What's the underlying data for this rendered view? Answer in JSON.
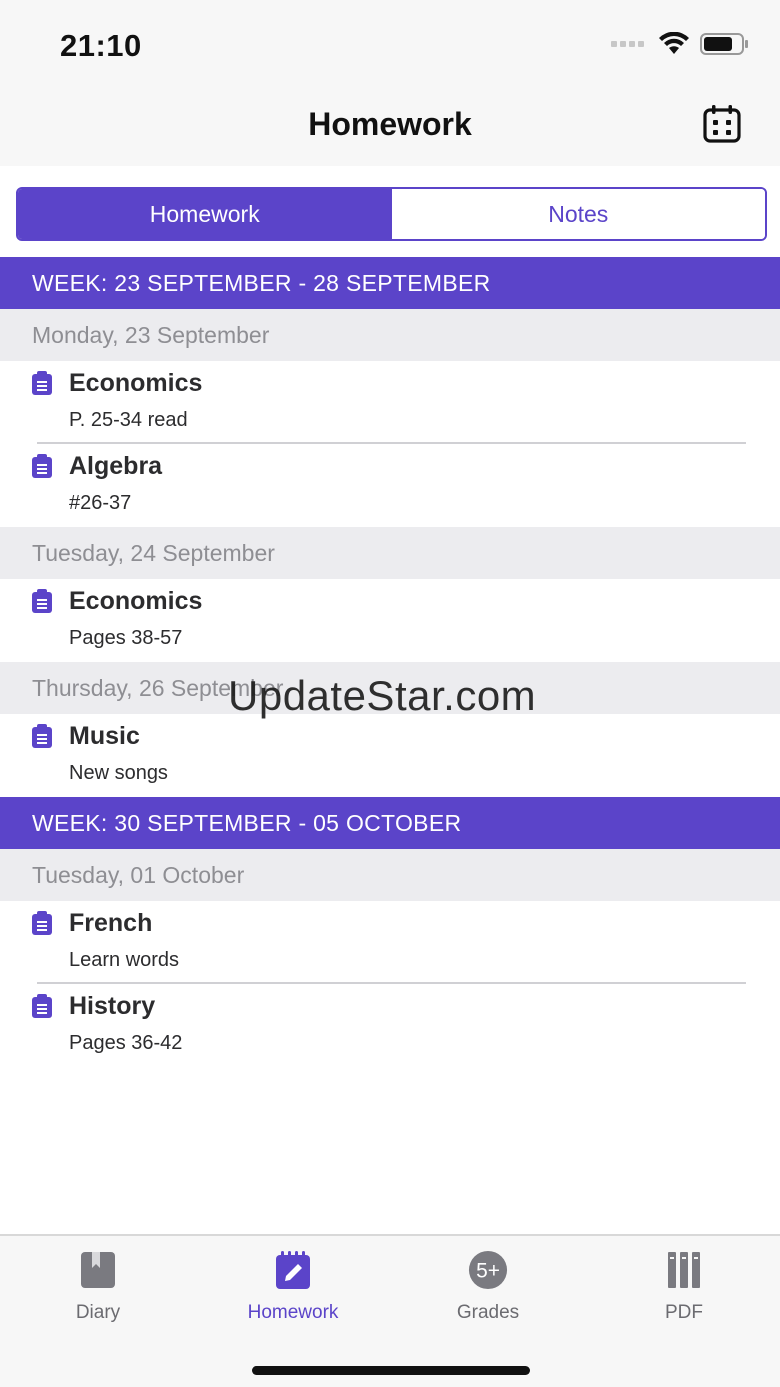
{
  "status": {
    "time": "21:10"
  },
  "nav": {
    "title": "Homework"
  },
  "segments": {
    "homework": "Homework",
    "notes": "Notes"
  },
  "weeks": [
    {
      "label": "WEEK: 23 SEPTEMBER - 28 SEPTEMBER",
      "days": [
        {
          "label": "Monday, 23 September",
          "items": [
            {
              "subject": "Economics",
              "task": "P. 25-34 read"
            },
            {
              "subject": "Algebra",
              "task": "#26-37"
            }
          ]
        },
        {
          "label": "Tuesday, 24 September",
          "items": [
            {
              "subject": "Economics",
              "task": "Pages 38-57"
            }
          ]
        },
        {
          "label": "Thursday, 26 September",
          "items": [
            {
              "subject": "Music",
              "task": "New songs"
            }
          ]
        }
      ]
    },
    {
      "label": "WEEK: 30 SEPTEMBER - 05 OCTOBER",
      "days": [
        {
          "label": "Tuesday, 01 October",
          "items": [
            {
              "subject": "French",
              "task": "Learn words"
            },
            {
              "subject": "History",
              "task": "Pages 36-42"
            }
          ]
        }
      ]
    }
  ],
  "watermark": "UpdateStar.com",
  "tabs": {
    "diary": "Diary",
    "homework": "Homework",
    "grades": "Grades",
    "grades_badge": "5+",
    "pdf": "PDF"
  },
  "colors": {
    "accent": "#5b44c9",
    "day_header_bg": "#ececef",
    "inactive_tab": "#6b6b70"
  }
}
